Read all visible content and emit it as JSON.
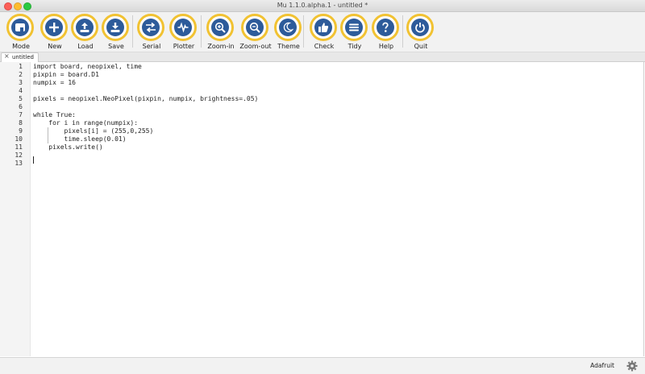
{
  "window": {
    "title": "Mu 1.1.0.alpha.1 - untitled *"
  },
  "toolbar": {
    "buttons": [
      {
        "id": "mode",
        "label": "Mode",
        "icon": "mode-icon"
      },
      {
        "id": "new",
        "label": "New",
        "icon": "plus-icon"
      },
      {
        "id": "load",
        "label": "Load",
        "icon": "upload-icon"
      },
      {
        "id": "save",
        "label": "Save",
        "icon": "download-icon"
      },
      {
        "id": "serial",
        "label": "Serial",
        "icon": "swap-arrows-icon"
      },
      {
        "id": "plotter",
        "label": "Plotter",
        "icon": "pulse-icon"
      },
      {
        "id": "zoom-in",
        "label": "Zoom-in",
        "icon": "zoom-in-icon"
      },
      {
        "id": "zoom-out",
        "label": "Zoom-out",
        "icon": "zoom-out-icon"
      },
      {
        "id": "theme",
        "label": "Theme",
        "icon": "moon-icon"
      },
      {
        "id": "check",
        "label": "Check",
        "icon": "thumbs-up-icon"
      },
      {
        "id": "tidy",
        "label": "Tidy",
        "icon": "lines-icon"
      },
      {
        "id": "help",
        "label": "Help",
        "icon": "question-icon"
      },
      {
        "id": "quit",
        "label": "Quit",
        "icon": "power-icon"
      }
    ],
    "accent_color": "#f1c232",
    "icon_color": "#2d5b9a"
  },
  "tabs": [
    {
      "label": "untitled *"
    }
  ],
  "editor": {
    "line_numbers": [
      "1",
      "2",
      "3",
      "4",
      "5",
      "6",
      "7",
      "8",
      "9",
      "10",
      "11",
      "12",
      "13"
    ],
    "lines": [
      "import board, neopixel, time",
      "pixpin = board.D1",
      "numpix = 16",
      "",
      "pixels = neopixel.NeoPixel(pixpin, numpix, brightness=.05)",
      "",
      "while True:",
      "    for i in range(numpix):",
      "        pixels[i] = (255,0,255)",
      "        time.sleep(0.01)",
      "    pixels.write()",
      "",
      ""
    ]
  },
  "statusbar": {
    "mode": "Adafruit",
    "icon": "gear-icon"
  }
}
